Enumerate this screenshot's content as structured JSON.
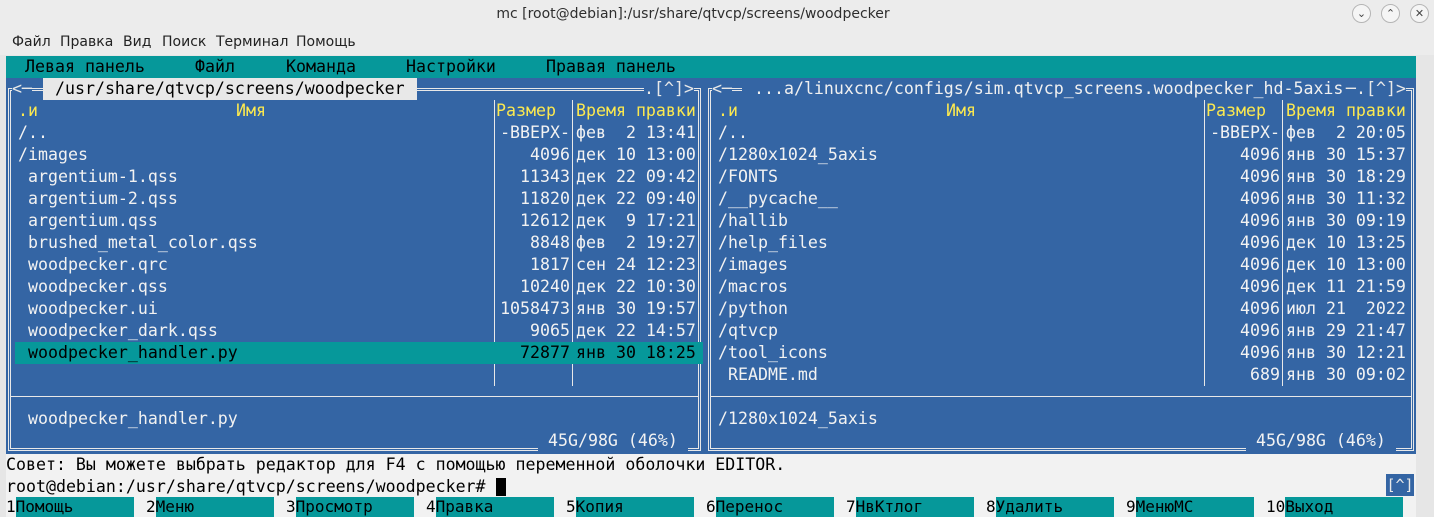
{
  "window": {
    "title": "mc [root@debian]:/usr/share/qtvcp/screens/woodpecker",
    "min_glyph": "⌄",
    "max_glyph": "⌃",
    "close_glyph": "✕"
  },
  "terminal_menu": [
    "Файл",
    "Правка",
    "Вид",
    "Поиск",
    "Терминал",
    "Помощь"
  ],
  "mc_menu": [
    "Левая панель",
    "Файл",
    "Команда",
    "Настройки",
    "Правая панель"
  ],
  "left_panel": {
    "path": " /usr/share/qtvcp/screens/woodpecker ",
    "corner_left": "<─",
    "corner_right": ".[^]>",
    "headers": {
      "sort": ".и",
      "name": "Имя",
      "size": "Размер",
      "time": "Время правки"
    },
    "rows": [
      {
        "name": "/..",
        "size": "-ВВЕРХ-",
        "time": "фев  2 13:41"
      },
      {
        "name": "/images",
        "size": "4096",
        "time": "дек 10 13:00"
      },
      {
        "name": " argentium-1.qss",
        "size": "11343",
        "time": "дек 22 09:42"
      },
      {
        "name": " argentium-2.qss",
        "size": "11820",
        "time": "дек 22 09:40"
      },
      {
        "name": " argentium.qss",
        "size": "12612",
        "time": "дек  9 17:21"
      },
      {
        "name": " brushed_metal_color.qss",
        "size": "8848",
        "time": "фев  2 19:27"
      },
      {
        "name": " woodpecker.qrc",
        "size": "1817",
        "time": "сен 24 12:23"
      },
      {
        "name": " woodpecker.qss",
        "size": "10240",
        "time": "дек 22 10:30"
      },
      {
        "name": " woodpecker.ui",
        "size": "1058473",
        "time": "янв 30 19:57"
      },
      {
        "name": " woodpecker_dark.qss",
        "size": "9065",
        "time": "дек 22 14:57"
      },
      {
        "name": " woodpecker_handler.py",
        "size": "72877",
        "time": "янв 30 18:25"
      }
    ],
    "mini_status": " woodpecker_handler.py",
    "disk": " 45G/98G (46%) "
  },
  "right_panel": {
    "path": " ...a/linuxcnc/configs/sim.qtvcp_screens.woodpecker_hd-5axis ",
    "corner_left": "<─",
    "corner_right": "─.[^]>",
    "headers": {
      "sort": ".и",
      "name": "Имя",
      "size": "Размер",
      "time": "Время правки"
    },
    "rows": [
      {
        "name": "/..",
        "size": "-ВВЕРХ-",
        "time": "фев  2 20:05"
      },
      {
        "name": "/1280x1024_5axis",
        "size": "4096",
        "time": "янв 30 15:37"
      },
      {
        "name": "/FONTS",
        "size": "4096",
        "time": "янв 30 18:29"
      },
      {
        "name": "/__pycache__",
        "size": "4096",
        "time": "янв 30 11:32"
      },
      {
        "name": "/hallib",
        "size": "4096",
        "time": "янв 30 09:19"
      },
      {
        "name": "/help_files",
        "size": "4096",
        "time": "дек 10 13:25"
      },
      {
        "name": "/images",
        "size": "4096",
        "time": "дек 10 13:00"
      },
      {
        "name": "/macros",
        "size": "4096",
        "time": "дек 11 21:59"
      },
      {
        "name": "/python",
        "size": "4096",
        "time": "июл 21  2022"
      },
      {
        "name": "/qtvcp",
        "size": "4096",
        "time": "янв 29 21:47"
      },
      {
        "name": "/tool_icons",
        "size": "4096",
        "time": "янв 30 12:21"
      },
      {
        "name": " README.md",
        "size": "689",
        "time": "янв 30 09:02"
      }
    ],
    "mini_status": "/1280x1024_5axis",
    "disk": " 45G/98G (46%) "
  },
  "hint": "Совет: Вы можете выбрать редактор для F4 с помощью переменной оболочки EDITOR.",
  "prompt": "root@debian:/usr/share/qtvcp/screens/woodpecker# ",
  "scroll_indicator": "[^]",
  "fkeys": [
    {
      "num": "1",
      "label": "Помощь"
    },
    {
      "num": "2",
      "label": "Меню"
    },
    {
      "num": "3",
      "label": "Просмотр"
    },
    {
      "num": "4",
      "label": "Правка"
    },
    {
      "num": "5",
      "label": "Копия"
    },
    {
      "num": "6",
      "label": "Перенос"
    },
    {
      "num": "7",
      "label": "НвКтлог"
    },
    {
      "num": "8",
      "label": "Удалить"
    },
    {
      "num": "9",
      "label": "МенюМС"
    },
    {
      "num": "10",
      "label": "Выход"
    }
  ],
  "colors": {
    "panel_bg": "#3465a4",
    "accent": "#06989a",
    "header_text": "#fce94f"
  }
}
